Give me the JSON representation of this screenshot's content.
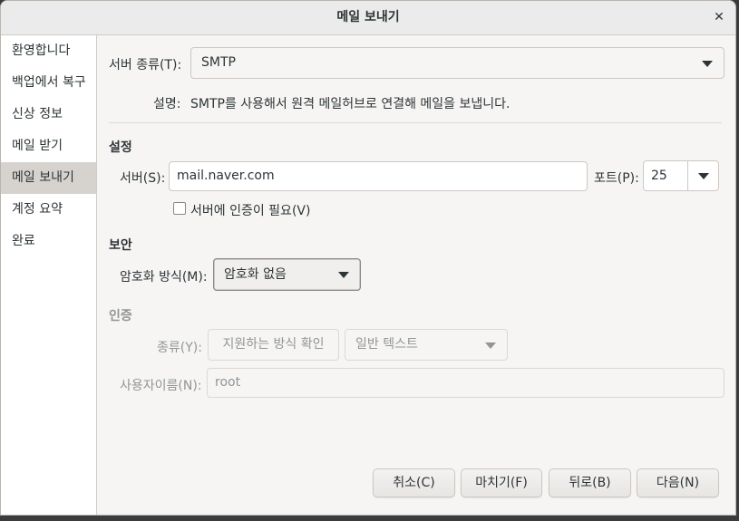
{
  "window": {
    "title": "메일 보내기",
    "close_glyph": "✕"
  },
  "sidebar": {
    "items": [
      {
        "label": "환영합니다"
      },
      {
        "label": "백업에서 복구"
      },
      {
        "label": "신상 정보"
      },
      {
        "label": "메일 받기"
      },
      {
        "label": "메일 보내기",
        "active": true
      },
      {
        "label": "계정 요약"
      },
      {
        "label": "완료"
      }
    ]
  },
  "server_type": {
    "label": "서버 종류(T):",
    "value": "SMTP"
  },
  "description": {
    "label": "설명:",
    "text": "SMTP를 사용해서 원격 메일허브로 연결해 메일을 보냅니다."
  },
  "settings": {
    "heading": "설정",
    "server_label": "서버(S):",
    "server_value": "mail.naver.com",
    "port_label": "포트(P):",
    "port_value": "25",
    "auth_required_label": "서버에 인증이 필요(V)",
    "auth_required_checked": false
  },
  "security": {
    "heading": "보안",
    "encryption_label": "암호화 방식(M):",
    "encryption_value": "암호화 없음"
  },
  "authentication": {
    "heading": "인증",
    "type_label": "종류(Y):",
    "check_button": "지원하는 방식 확인",
    "type_value": "일반 텍스트",
    "username_label": "사용자이름(N):",
    "username_value": "root"
  },
  "buttons": {
    "cancel": "취소(C)",
    "finish": "마치기(F)",
    "back": "뒤로(B)",
    "next": "다음(N)"
  },
  "colors": {
    "sidebar_active": "#d6d3cf",
    "window_bg": "#f6f5f4",
    "disabled_text": "#929595"
  }
}
